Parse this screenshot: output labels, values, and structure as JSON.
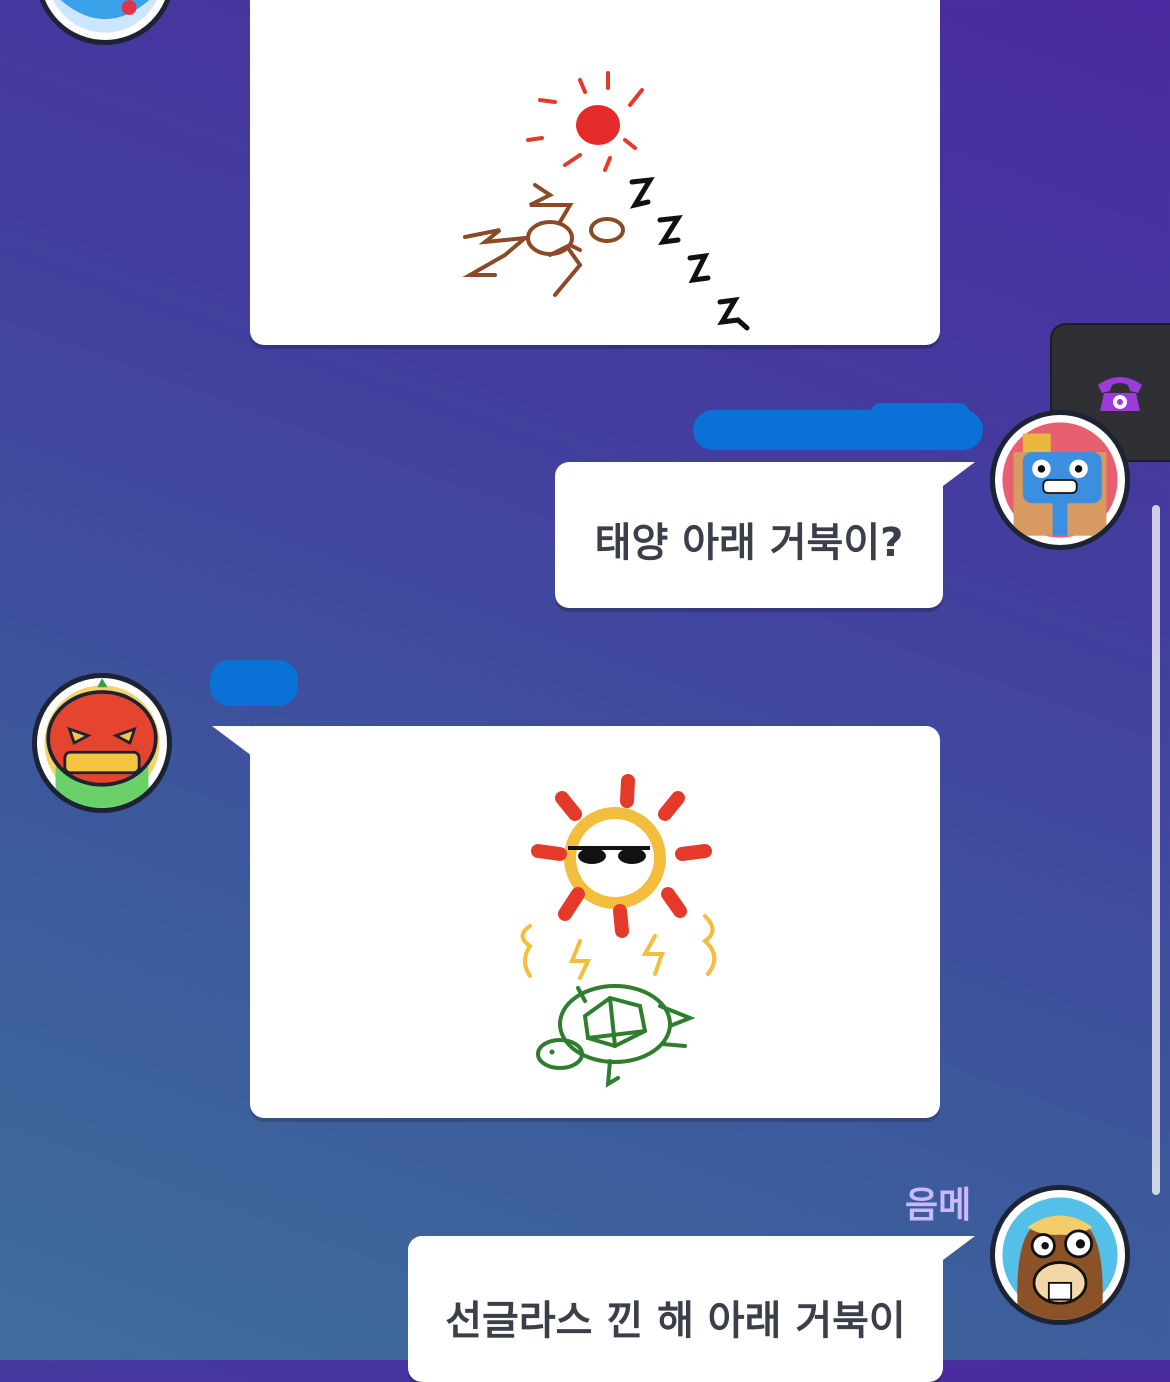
{
  "messages": [
    {
      "type": "drawing",
      "drawing": "sleeping-person-under-sun"
    },
    {
      "type": "text",
      "text": "태양 아래 거북이?"
    },
    {
      "type": "drawing",
      "drawing": "sun-with-sunglasses-and-turtle"
    },
    {
      "type": "text",
      "sender": "음메",
      "text": "선글라스 낀 해 아래 거북이"
    }
  ],
  "icons": {
    "call_button": "telephone-icon",
    "avatars": [
      "blue-monster-avatar",
      "crowned-monster-avatar",
      "pumpkin-avatar",
      "llama-avatar"
    ]
  },
  "colors": {
    "accent": "#7a2fb8",
    "redaction": "#0a72d6",
    "sender_name": "#c9b9ff"
  }
}
